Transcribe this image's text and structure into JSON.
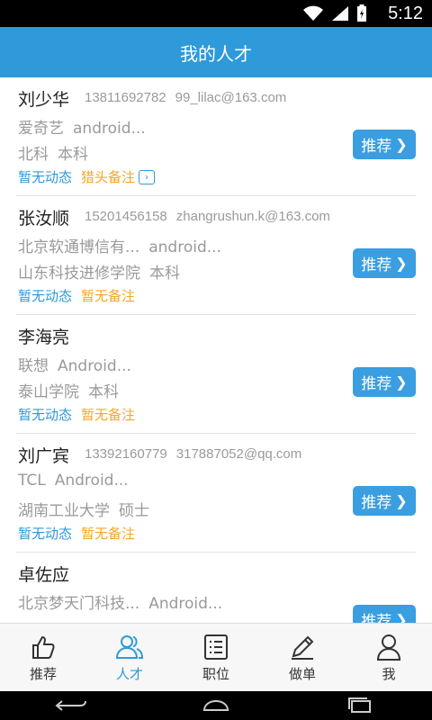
{
  "status": {
    "time": "5:12"
  },
  "header": {
    "title": "我的人才"
  },
  "candidates": [
    {
      "name": "刘少华",
      "phone": "13811692782",
      "email": "99_lilac@163.com",
      "company": "爱奇艺",
      "role": "android...",
      "school": "北科",
      "degree": "本科",
      "activity": "暂无动态",
      "note": "猎头备注",
      "has_note_link": true,
      "recommend_label": "推荐"
    },
    {
      "name": "张汝顺",
      "phone": "15201456158",
      "email": "zhangrushun.k@163.com",
      "company": "北京软通博信有...",
      "role": "android...",
      "school": "山东科技进修学院",
      "degree": "本科",
      "activity": "暂无动态",
      "note": "暂无备注",
      "has_note_link": false,
      "recommend_label": "推荐"
    },
    {
      "name": "李海亮",
      "phone": "",
      "email": "",
      "company": "联想",
      "role": "Android...",
      "school": "泰山学院",
      "degree": "本科",
      "activity": "暂无动态",
      "note": "暂无备注",
      "has_note_link": false,
      "recommend_label": "推荐"
    },
    {
      "name": "刘广宾",
      "phone": "13392160779",
      "email": "317887052@qq.com",
      "company": "TCL",
      "role": "Android...",
      "school": "湖南工业大学",
      "degree": "硕士",
      "activity": "暂无动态",
      "note": "暂无备注",
      "has_note_link": false,
      "recommend_label": "推荐"
    },
    {
      "name": "卓佐应",
      "phone": "",
      "email": "",
      "company": "北京梦天门科技...",
      "role": "Android...",
      "school": "",
      "degree": "",
      "activity": "",
      "note": "",
      "has_note_link": false,
      "recommend_label": "推荐"
    }
  ],
  "bottom_nav": [
    {
      "label": "推荐",
      "icon": "thumbs-up-icon",
      "active": false
    },
    {
      "label": "人才",
      "icon": "people-icon",
      "active": true
    },
    {
      "label": "职位",
      "icon": "list-icon",
      "active": false
    },
    {
      "label": "做单",
      "icon": "pen-icon",
      "active": false
    },
    {
      "label": "我",
      "icon": "person-icon",
      "active": false
    }
  ],
  "colors": {
    "accent": "#2e9ad9",
    "note_orange": "#f5a623",
    "muted_text": "#9a9a9a"
  }
}
